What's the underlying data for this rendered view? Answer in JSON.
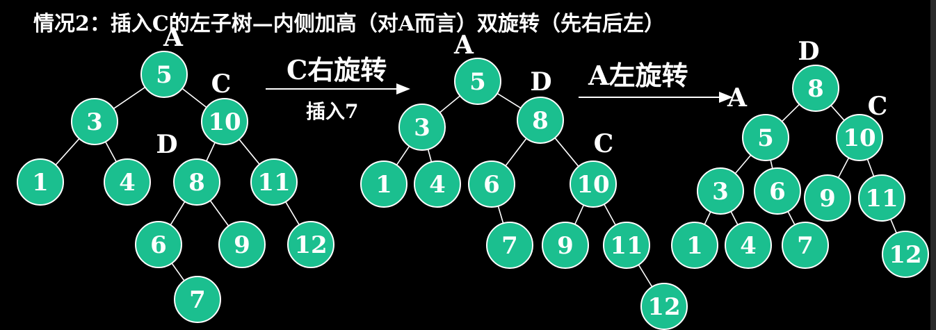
{
  "title": "情况2：插入C的左子树—内侧加高（对A而言）双旋转（先右后左）",
  "colors": {
    "background": "#000000",
    "node_fill": "#1bbf8f",
    "text": "#ffffff"
  },
  "operations": [
    {
      "label": "C右旋转",
      "sublabel": "插入7"
    },
    {
      "label": "A左旋转",
      "sublabel": ""
    }
  ],
  "trees": [
    {
      "nodes": [
        {
          "id": "n5",
          "value": "5"
        },
        {
          "id": "n3",
          "value": "3"
        },
        {
          "id": "n10",
          "value": "10"
        },
        {
          "id": "n1",
          "value": "1"
        },
        {
          "id": "n4",
          "value": "4"
        },
        {
          "id": "n8",
          "value": "8"
        },
        {
          "id": "n11",
          "value": "11"
        },
        {
          "id": "n6",
          "value": "6"
        },
        {
          "id": "n9",
          "value": "9"
        },
        {
          "id": "n12",
          "value": "12"
        },
        {
          "id": "n7",
          "value": "7"
        }
      ],
      "edges": [
        [
          "n5",
          "n3"
        ],
        [
          "n5",
          "n10"
        ],
        [
          "n3",
          "n1"
        ],
        [
          "n3",
          "n4"
        ],
        [
          "n10",
          "n8"
        ],
        [
          "n10",
          "n11"
        ],
        [
          "n8",
          "n6"
        ],
        [
          "n8",
          "n9"
        ],
        [
          "n11",
          "n12"
        ],
        [
          "n6",
          "n7"
        ]
      ],
      "tags": [
        {
          "text": "A",
          "node": "n5"
        },
        {
          "text": "C",
          "node": "n10"
        },
        {
          "text": "D",
          "node": "n8"
        }
      ]
    },
    {
      "nodes": [
        {
          "id": "n5",
          "value": "5"
        },
        {
          "id": "n3",
          "value": "3"
        },
        {
          "id": "n8",
          "value": "8"
        },
        {
          "id": "n1",
          "value": "1"
        },
        {
          "id": "n4",
          "value": "4"
        },
        {
          "id": "n6",
          "value": "6"
        },
        {
          "id": "n10",
          "value": "10"
        },
        {
          "id": "n7",
          "value": "7"
        },
        {
          "id": "n9",
          "value": "9"
        },
        {
          "id": "n11",
          "value": "11"
        },
        {
          "id": "n12",
          "value": "12"
        }
      ],
      "edges": [
        [
          "n5",
          "n3"
        ],
        [
          "n5",
          "n8"
        ],
        [
          "n3",
          "n1"
        ],
        [
          "n3",
          "n4"
        ],
        [
          "n8",
          "n6"
        ],
        [
          "n8",
          "n10"
        ],
        [
          "n6",
          "n7"
        ],
        [
          "n10",
          "n9"
        ],
        [
          "n10",
          "n11"
        ],
        [
          "n11",
          "n12"
        ]
      ],
      "tags": [
        {
          "text": "A",
          "node": "n5"
        },
        {
          "text": "D",
          "node": "n8"
        },
        {
          "text": "C",
          "node": "n10"
        }
      ]
    },
    {
      "nodes": [
        {
          "id": "n8",
          "value": "8"
        },
        {
          "id": "n5",
          "value": "5"
        },
        {
          "id": "n10",
          "value": "10"
        },
        {
          "id": "n3",
          "value": "3"
        },
        {
          "id": "n6",
          "value": "6"
        },
        {
          "id": "n9",
          "value": "9"
        },
        {
          "id": "n11",
          "value": "11"
        },
        {
          "id": "n1",
          "value": "1"
        },
        {
          "id": "n4",
          "value": "4"
        },
        {
          "id": "n7",
          "value": "7"
        },
        {
          "id": "n12",
          "value": "12"
        }
      ],
      "edges": [
        [
          "n8",
          "n5"
        ],
        [
          "n8",
          "n10"
        ],
        [
          "n5",
          "n3"
        ],
        [
          "n5",
          "n6"
        ],
        [
          "n10",
          "n9"
        ],
        [
          "n10",
          "n11"
        ],
        [
          "n3",
          "n1"
        ],
        [
          "n3",
          "n4"
        ],
        [
          "n6",
          "n7"
        ],
        [
          "n11",
          "n12"
        ]
      ],
      "tags": [
        {
          "text": "D",
          "node": "n8"
        },
        {
          "text": "A",
          "node": "n5"
        },
        {
          "text": "C",
          "node": "n10"
        }
      ]
    }
  ]
}
